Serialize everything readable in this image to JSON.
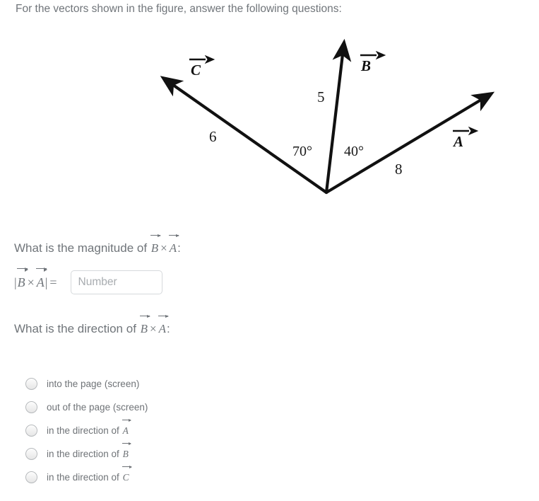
{
  "prompt": "For the vectors shown in the figure, answer the following questions:",
  "figure": {
    "alt_name": "vector-diagram",
    "vectors": [
      {
        "name": "C",
        "label": "C",
        "magnitude": "6",
        "magnitude_label": "6",
        "direction_deg": 145
      },
      {
        "name": "B",
        "label": "B",
        "magnitude": "5",
        "magnitude_label": "5",
        "direction_deg": 85
      },
      {
        "name": "A",
        "label": "A",
        "magnitude": "8",
        "magnitude_label": "8",
        "direction_deg": 45
      }
    ],
    "angles": [
      {
        "name": "angle-C-B",
        "label": "70°",
        "between": "C and B"
      },
      {
        "name": "angle-B-A",
        "label": "40°",
        "between": "B and A"
      }
    ],
    "stroke_color": "#111111"
  },
  "question1": {
    "text_before": "What is the magnitude of ",
    "vec1": "B",
    "cross": "×",
    "vec2": "A",
    "text_after": ":",
    "expr_open": "|",
    "expr_close": "|",
    "equals": "=",
    "input_placeholder": "Number",
    "input_value": ""
  },
  "question2": {
    "text_before": "What is the direction of ",
    "vec1": "B",
    "cross": "×",
    "vec2": "A",
    "text_after": ":"
  },
  "options": [
    {
      "id": "into-page",
      "label": "into the page (screen)",
      "has_vector": false,
      "vector": "",
      "selected": false
    },
    {
      "id": "out-of-page",
      "label": "out of the page (screen)",
      "has_vector": false,
      "vector": "",
      "selected": false
    },
    {
      "id": "direction-a",
      "label": "in the direction of ",
      "has_vector": true,
      "vector": "A",
      "selected": false
    },
    {
      "id": "direction-b",
      "label": "in the direction of ",
      "has_vector": true,
      "vector": "B",
      "selected": false
    },
    {
      "id": "direction-c",
      "label": "in the direction of ",
      "has_vector": true,
      "vector": "C",
      "selected": false
    }
  ],
  "colors": {
    "text": "#70757a",
    "figure_stroke": "#111111",
    "input_border": "#d6d9dc",
    "placeholder": "#a8acb0"
  }
}
